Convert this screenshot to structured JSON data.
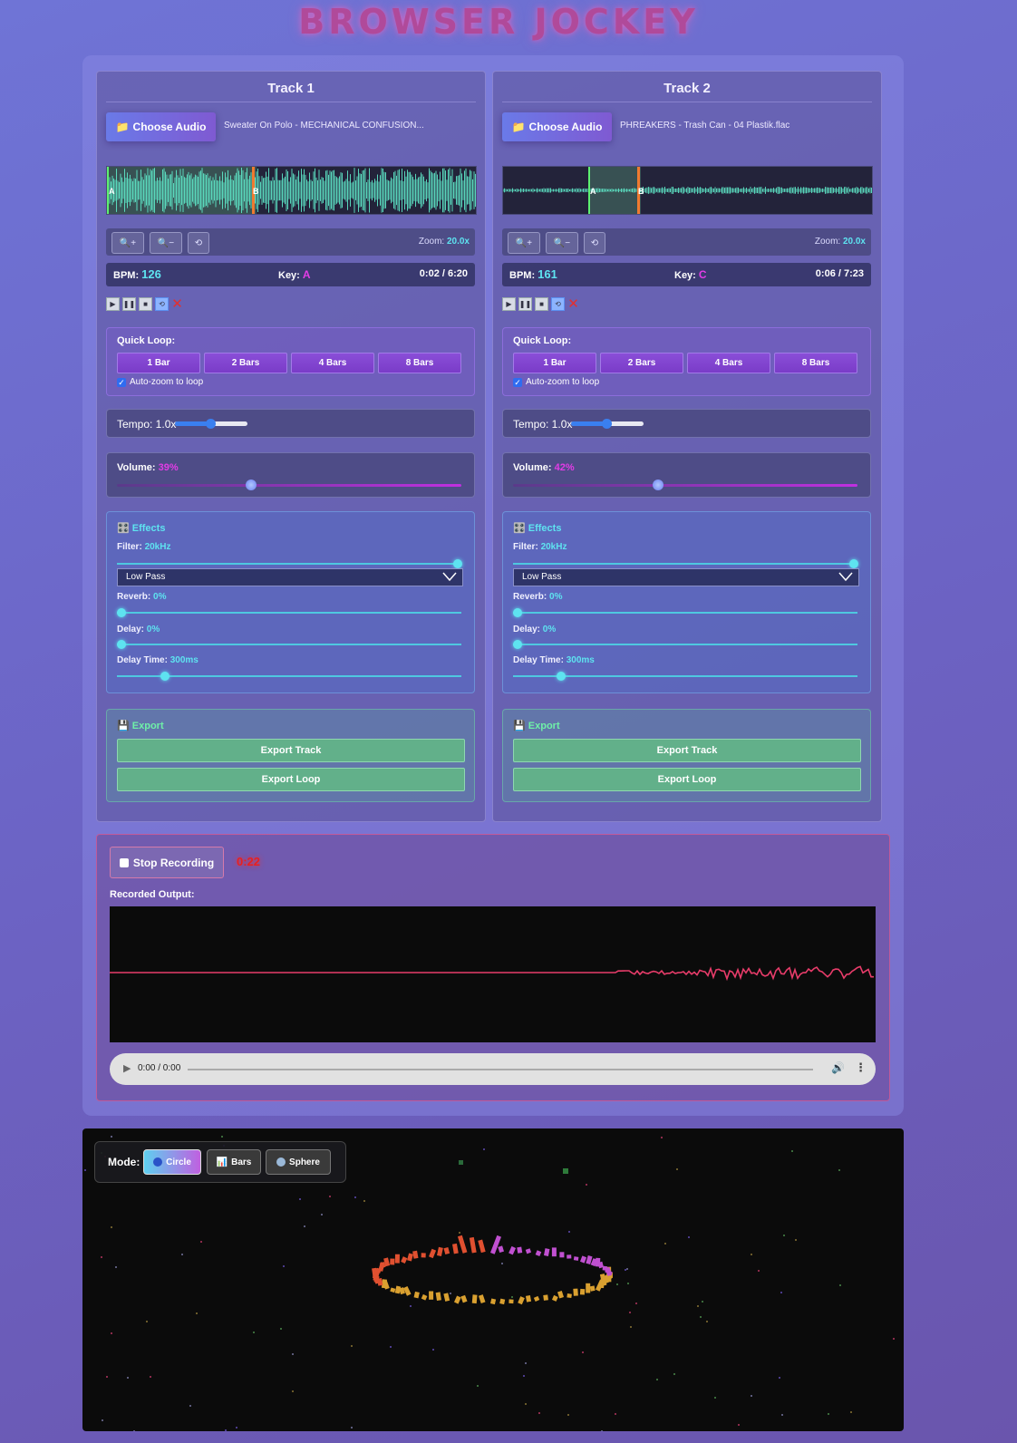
{
  "app": {
    "title": "BROWSER JOCKEY"
  },
  "tracks": [
    {
      "title": "Track 1",
      "choose_label": "Choose Audio",
      "filename": "Sweater On Polo - MECHANICAL CONFUSION...",
      "zoom_in": "🔍+",
      "zoom_out": "🔍−",
      "zoom_reset": "⟲",
      "zoom_label": "Zoom:",
      "zoom_value": "20.0x",
      "bpm_label": "BPM:",
      "bpm": "126",
      "key_label": "Key:",
      "key": "A",
      "time": "0:02 / 6:20",
      "markers": {
        "a": "A",
        "b": "B"
      },
      "quick_loop": {
        "title": "Quick Loop:",
        "options": [
          "1 Bar",
          "2 Bars",
          "4 Bars",
          "8 Bars"
        ],
        "auto_zoom": "Auto-zoom to loop"
      },
      "tempo": {
        "label": "Tempo: 1.0x",
        "value": 0.5
      },
      "volume": {
        "label": "Volume:",
        "value": "39%",
        "fraction": 0.39
      },
      "effects": {
        "title": "Effects",
        "filter_label": "Filter:",
        "filter_value": "20kHz",
        "filter_type": "Low Pass",
        "reverb_label": "Reverb:",
        "reverb_value": "0%",
        "delay_label": "Delay:",
        "delay_value": "0%",
        "delay_time_label": "Delay Time:",
        "delay_time_value": "300ms"
      },
      "export": {
        "title": "Export",
        "track_btn": "Export Track",
        "loop_btn": "Export Loop"
      }
    },
    {
      "title": "Track 2",
      "choose_label": "Choose Audio",
      "filename": "PHREAKERS - Trash Can - 04 Plastik.flac",
      "zoom_in": "🔍+",
      "zoom_out": "🔍−",
      "zoom_reset": "⟲",
      "zoom_label": "Zoom:",
      "zoom_value": "20.0x",
      "bpm_label": "BPM:",
      "bpm": "161",
      "key_label": "Key:",
      "key": "C",
      "time": "0:06 / 7:23",
      "markers": {
        "a": "A",
        "b": "B"
      },
      "quick_loop": {
        "title": "Quick Loop:",
        "options": [
          "1 Bar",
          "2 Bars",
          "4 Bars",
          "8 Bars"
        ],
        "auto_zoom": "Auto-zoom to loop"
      },
      "tempo": {
        "label": "Tempo: 1.0x",
        "value": 0.5
      },
      "volume": {
        "label": "Volume:",
        "value": "42%",
        "fraction": 0.42
      },
      "effects": {
        "title": "Effects",
        "filter_label": "Filter:",
        "filter_value": "20kHz",
        "filter_type": "Low Pass",
        "reverb_label": "Reverb:",
        "reverb_value": "0%",
        "delay_label": "Delay:",
        "delay_value": "0%",
        "delay_time_label": "Delay Time:",
        "delay_time_value": "300ms"
      },
      "export": {
        "title": "Export",
        "track_btn": "Export Track",
        "loop_btn": "Export Loop"
      }
    }
  ],
  "recorder": {
    "stop_label": "Stop Recording",
    "timer": "0:22",
    "output_label": "Recorded Output:",
    "player_time": "0:00 / 0:00"
  },
  "visualizer": {
    "mode_label": "Mode:",
    "modes": [
      {
        "label": "Circle",
        "active": true
      },
      {
        "label": "Bars",
        "active": false
      },
      {
        "label": "Sphere",
        "active": false
      }
    ]
  },
  "colors": {
    "accent_cyan": "#5ee3f0",
    "accent_magenta": "#e23ce6",
    "recording_red": "#e82020",
    "export_green": "#62b08a"
  }
}
